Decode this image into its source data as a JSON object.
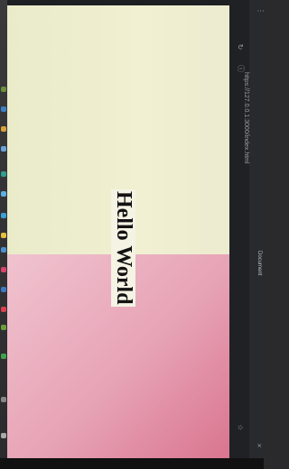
{
  "browser": {
    "url": "https://127.0.0.1:3000/index.html",
    "tab_title": "Document"
  },
  "page": {
    "heading": "Hello World"
  },
  "colors": {
    "top_background": "#efeed0",
    "bottom_background": "#e6a2b5",
    "heading_color": "#121212"
  },
  "icons": [
    "back-icon",
    "forward-icon",
    "reload-icon",
    "info-icon",
    "star-icon",
    "menu-icon"
  ]
}
